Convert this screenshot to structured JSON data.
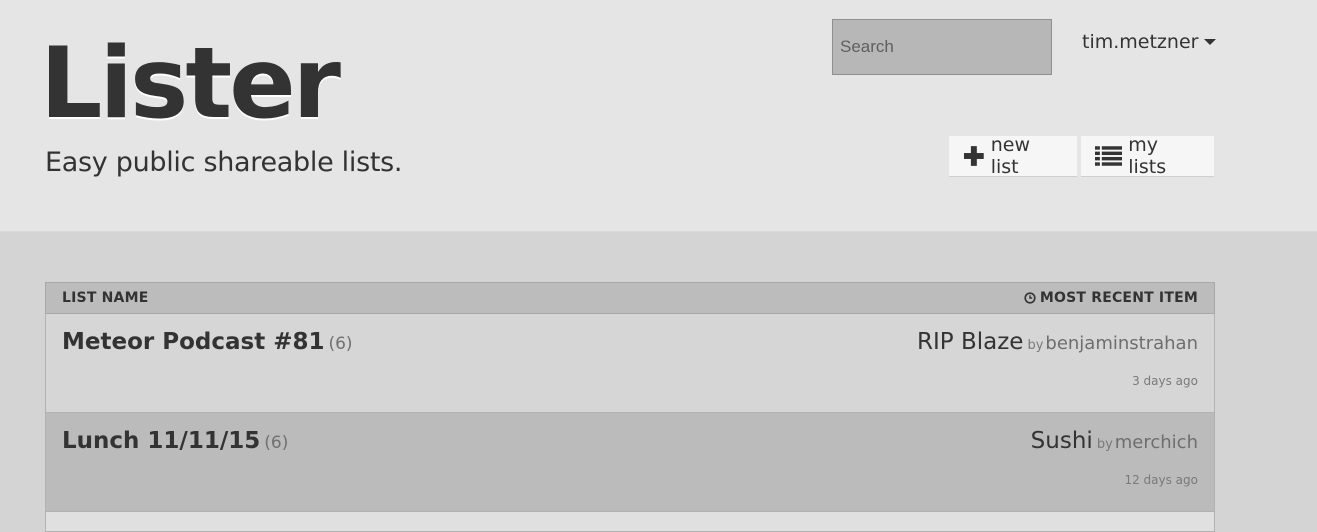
{
  "header": {
    "brand": "Lister",
    "tagline": "Easy public shareable lists."
  },
  "search": {
    "placeholder": "Search"
  },
  "user": {
    "name": "tim.metzner"
  },
  "actions": {
    "new_list": "new list",
    "my_lists": "my lists"
  },
  "table": {
    "col_name": "LIST NAME",
    "col_recent": "MOST RECENT ITEM",
    "rows": [
      {
        "name": "Meteor Podcast #81",
        "count": "(6)",
        "item": "RIP Blaze",
        "by": "by",
        "author": "benjaminstrahan",
        "time": "3 days ago"
      },
      {
        "name": "Lunch 11/11/15",
        "count": "(6)",
        "item": "Sushi",
        "by": "by",
        "author": "merchich",
        "time": "12 days ago"
      }
    ]
  },
  "colors": {
    "header_bg": "#e5e5e5",
    "body_bg": "#d4d4d4",
    "text": "#333333"
  }
}
